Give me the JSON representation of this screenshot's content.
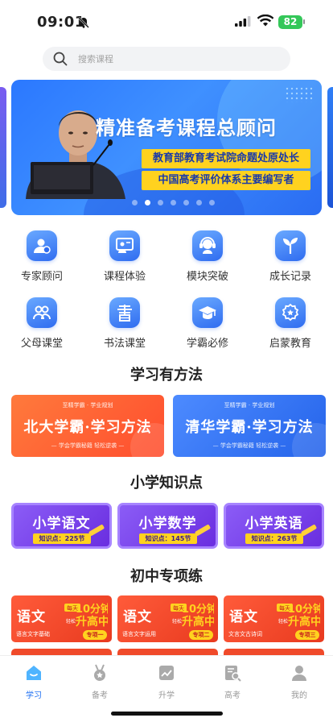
{
  "status_bar": {
    "time": "09:01",
    "battery": "82"
  },
  "search": {
    "placeholder": "搜索课程"
  },
  "banner": {
    "title": "精准备考课程总顾问",
    "lines": [
      "教育部教育考试院命题处原处长",
      "中国高考评价体系主要编写者"
    ],
    "page_count": 7,
    "active_page": 2
  },
  "grid": [
    {
      "label": "专家顾问",
      "icon": "expert-icon"
    },
    {
      "label": "课程体验",
      "icon": "course-trial-icon"
    },
    {
      "label": "模块突破",
      "icon": "module-icon"
    },
    {
      "label": "成长记录",
      "icon": "growth-icon"
    },
    {
      "label": "父母课堂",
      "icon": "parents-icon"
    },
    {
      "label": "书法课堂",
      "icon": "calligraphy-icon"
    },
    {
      "label": "学霸必修",
      "icon": "graduation-cap-icon"
    },
    {
      "label": "启蒙教育",
      "icon": "badge-icon"
    }
  ],
  "sections": {
    "methods_title": "学习有方法",
    "primary_title": "小学知识点",
    "middle_title": "初中专项练"
  },
  "methods": [
    {
      "brand": "至精学霸 · 学业规划",
      "title": "北大学霸·学习方法",
      "sub": "— 学会学霸秘籍  轻松逆袭 —"
    },
    {
      "brand": "至精学霸 · 学业规划",
      "title": "清华学霸·学习方法",
      "sub": "— 学会学霸秘籍  轻松逆袭 —"
    }
  ],
  "primary": [
    {
      "title": "小学语文",
      "count": "知识点：225节"
    },
    {
      "title": "小学数学",
      "count": "知识点：145节"
    },
    {
      "title": "小学英语",
      "count": "知识点：263节"
    }
  ],
  "middle": [
    {
      "title": "语文",
      "promo_top": "每天",
      "promo_mid": "10分钟",
      "promo_easy": "轻松",
      "promo_big": "升高中",
      "desc": "语言文字基础",
      "badge": "专项一"
    },
    {
      "title": "语文",
      "promo_top": "每天",
      "promo_mid": "10分钟",
      "promo_easy": "轻松",
      "promo_big": "升高中",
      "desc": "语言文字运用",
      "badge": "专项二"
    },
    {
      "title": "语文",
      "promo_top": "每天",
      "promo_mid": "10分钟",
      "promo_easy": "轻松",
      "promo_big": "升高中",
      "desc": "文言文古诗词",
      "badge": "专项三"
    }
  ],
  "tabs": [
    {
      "label": "学习",
      "icon": "home-study-icon",
      "active": true
    },
    {
      "label": "备考",
      "icon": "medal-icon",
      "active": false
    },
    {
      "label": "升学",
      "icon": "chart-icon",
      "active": false
    },
    {
      "label": "高考",
      "icon": "exam-search-icon",
      "active": false
    },
    {
      "label": "我的",
      "icon": "profile-icon",
      "active": false
    }
  ],
  "colors": {
    "accent": "#1e6ff2",
    "banner_blue": "#2b78ff",
    "highlight_yellow": "#ffd21f",
    "method_orange": "#ff5b3a",
    "primary_purple": "#7c3aed"
  }
}
